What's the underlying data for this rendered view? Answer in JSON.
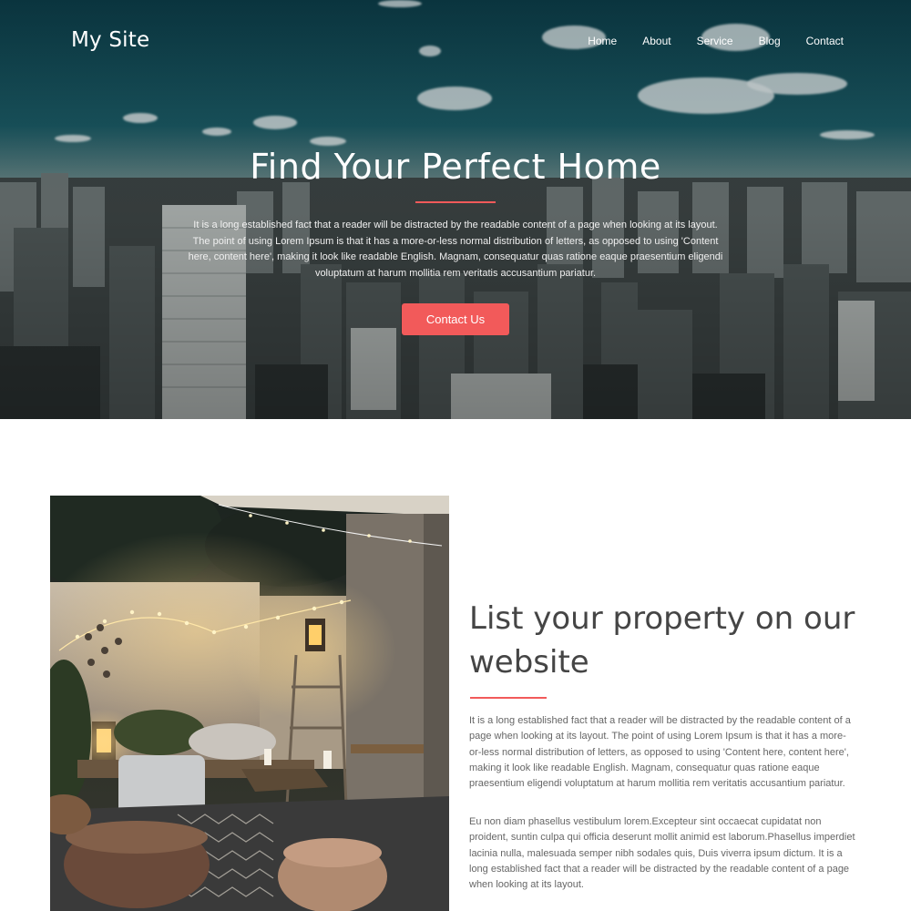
{
  "header": {
    "logo": "My Site",
    "nav": [
      "Home",
      "About",
      "Service",
      "Blog",
      "Contact"
    ]
  },
  "hero": {
    "title": "Find Your Perfect Home",
    "text": "It is a long established fact that a reader will be distracted by the readable content of a page when looking at its layout. The point of using Lorem Ipsum is that it has a more-or-less normal distribution of letters, as opposed to using 'Content here, content here', making it look like readable English. Magnam, consequatur quas ratione eaque praesentium eligendi voluptatum at harum mollitia rem veritatis accusantium pariatur.",
    "button": "Contact Us"
  },
  "about": {
    "title": "List your property on our website",
    "paragraph1": "It is a long established fact that a reader will be distracted by the readable content of a page when looking at its layout. The point of using Lorem Ipsum is that it has a more-or-less normal distribution of letters, as opposed to using 'Content here, content here', making it look like readable English. Magnam, consequatur quas ratione eaque praesentium eligendi voluptatum at harum mollitia rem veritatis accusantium pariatur.",
    "paragraph2": "Eu non diam phasellus vestibulum lorem.Excepteur sint occaecat cupidatat non proident, suntin culpa qui officia deserunt mollit animid est laborum.Phasellus imperdiet lacinia nulla, malesuada semper nibh sodales quis, Duis viverra ipsum dictum. It is a long established fact that a reader will be distracted by the readable content of a page when looking at its layout."
  },
  "colors": {
    "accent": "#f25a5a",
    "heading": "#454545",
    "body_text": "#666666"
  }
}
